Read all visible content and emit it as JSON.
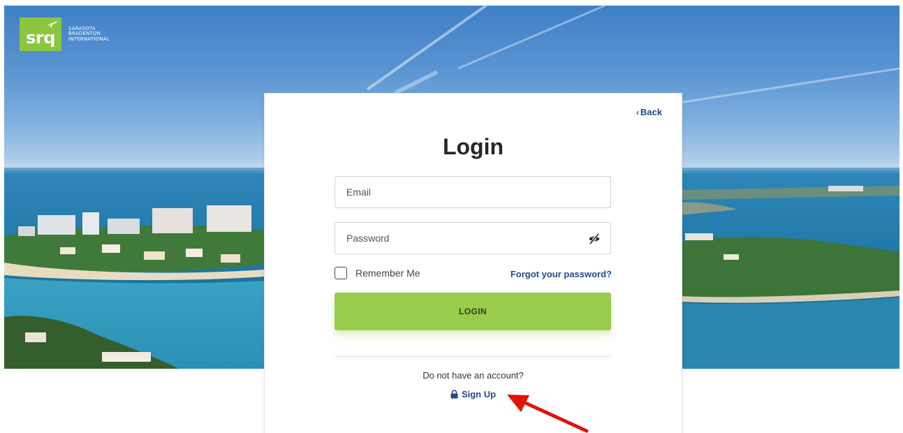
{
  "logo": {
    "mark_text": "srq",
    "lines": [
      "SARASOTA",
      "BRADENTON",
      "INTERNATIONAL"
    ]
  },
  "card": {
    "back_label": "Back",
    "title": "Login",
    "email": {
      "value": "",
      "placeholder": "Email"
    },
    "password": {
      "value": "",
      "placeholder": "Password"
    },
    "remember_label": "Remember Me",
    "remember_checked": false,
    "forgot_label": "Forgot your password?",
    "login_label": "LOGIN",
    "no_account_text": "Do not have an account?",
    "signup_label": "Sign Up"
  },
  "icons": {
    "back": "chevron-left-icon",
    "plane": "airplane-icon",
    "password_toggle": "eye-slash-icon",
    "signup": "lock-icon",
    "annotation": "red-arrow-annotation"
  },
  "colors": {
    "brand_green": "#8cc63f",
    "button_green": "#99cc4d",
    "link_blue": "#1e4a8c",
    "annotation_red": "#e3120b"
  }
}
